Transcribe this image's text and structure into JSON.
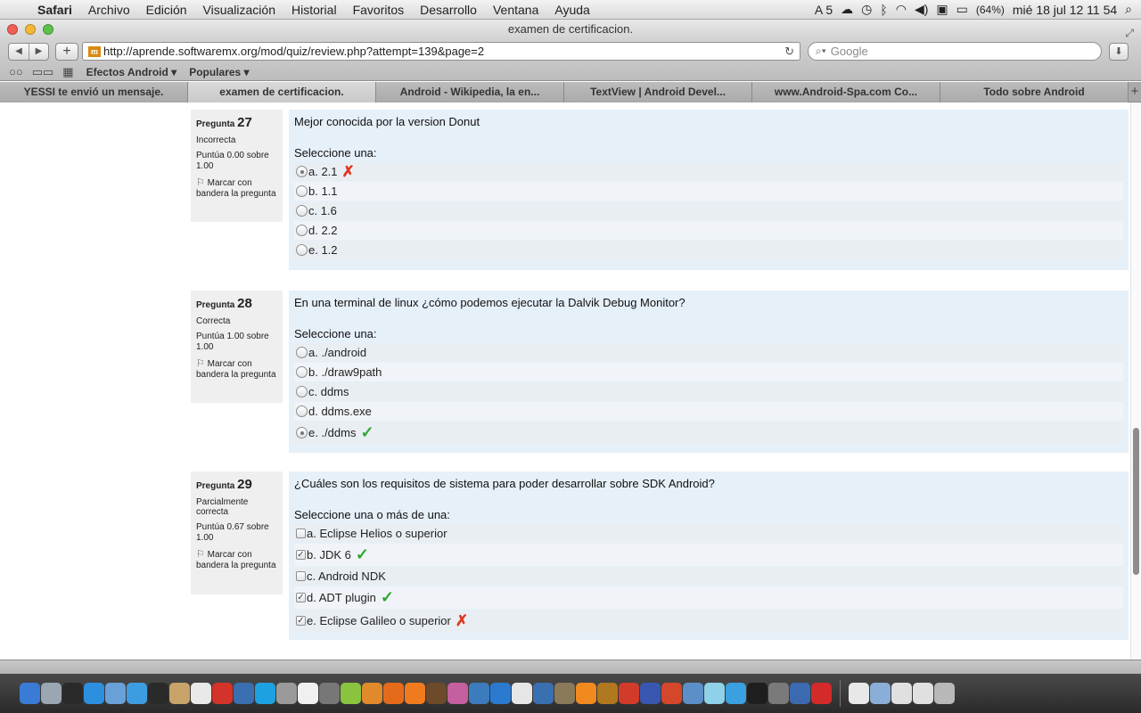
{
  "menubar": {
    "apple": "",
    "items": [
      "Safari",
      "Archivo",
      "Edición",
      "Visualización",
      "Historial",
      "Favoritos",
      "Desarrollo",
      "Ventana",
      "Ayuda"
    ],
    "status_adobe": "5",
    "battery": "(64%)",
    "clock": "mié 18 jul  12 11 54"
  },
  "window": {
    "title": "examen de certificacion."
  },
  "toolbar": {
    "url": "http://aprende.softwaremx.org/mod/quiz/review.php?attempt=139&page=2",
    "favicon": "m",
    "search_placeholder": "Google"
  },
  "bookmarks": [
    "Efectos Android ▾",
    "Populares ▾"
  ],
  "tabs": [
    "YESSI te envió un mensaje.",
    "examen de certificacion.",
    "Android - Wikipedia, la en...",
    "TextView | Android Devel...",
    "www.Android-Spa.com Co...",
    "Todo sobre Android"
  ],
  "questions": [
    {
      "label": "Pregunta",
      "number": "27",
      "state": "Incorrecta",
      "grade": "Puntúa 0.00 sobre 1.00",
      "flag": "Marcar con bandera la pregunta",
      "text": "Mejor conocida por la version Donut",
      "prompt": "Seleccione una:",
      "answers": [
        {
          "text": "a. 2.1",
          "selected": true,
          "mark": "✗"
        },
        {
          "text": "b. 1.1",
          "selected": false,
          "mark": ""
        },
        {
          "text": "c. 1.6",
          "selected": false,
          "mark": ""
        },
        {
          "text": "d. 2.2",
          "selected": false,
          "mark": ""
        },
        {
          "text": "e. 1.2",
          "selected": false,
          "mark": ""
        }
      ]
    },
    {
      "label": "Pregunta",
      "number": "28",
      "state": "Correcta",
      "grade": "Puntúa 1.00 sobre 1.00",
      "flag": "Marcar con bandera la pregunta",
      "text": "En una terminal de linux ¿cómo podemos ejecutar la Dalvik Debug Monitor?",
      "prompt": "Seleccione una:",
      "answers": [
        {
          "text": "a. ./android",
          "selected": false,
          "mark": ""
        },
        {
          "text": "b. ./draw9path",
          "selected": false,
          "mark": ""
        },
        {
          "text": "c. ddms",
          "selected": false,
          "mark": ""
        },
        {
          "text": "d. ddms.exe",
          "selected": false,
          "mark": ""
        },
        {
          "text": "e. ./ddms",
          "selected": true,
          "mark": "✓"
        }
      ]
    },
    {
      "label": "Pregunta",
      "number": "29",
      "state": "Parcialmente correcta",
      "grade": "Puntúa 0.67 sobre 1.00",
      "flag": "Marcar con bandera la pregunta",
      "text": "¿Cuáles son los requisitos de sistema para poder desarrollar sobre SDK Android?",
      "prompt": "Seleccione una o más de una:",
      "answers": [
        {
          "text": "a. Eclipse Helios o superior",
          "selected": false,
          "mark": ""
        },
        {
          "text": "b. JDK 6",
          "selected": true,
          "mark": "✓"
        },
        {
          "text": "c. Android NDK",
          "selected": false,
          "mark": ""
        },
        {
          "text": "d. ADT plugin",
          "selected": true,
          "mark": "✓"
        },
        {
          "text": "e. Eclipse Galileo o superior",
          "selected": true,
          "mark": "✗"
        }
      ]
    }
  ],
  "dock": {
    "icons": [
      "finder-icon",
      "launchpad-icon",
      "dashboard-icon",
      "appstore-icon",
      "preview-icon",
      "safari-icon",
      "x11-icon",
      "cyberduck-icon",
      "calendar-icon",
      "filezilla-icon",
      "virtualbox-icon",
      "skype-icon",
      "utility-icon",
      "textedit-icon",
      "photo-icon",
      "android-icon",
      "blender-icon",
      "firefox-icon",
      "illustrator-icon",
      "lingon-icon",
      "app-icon",
      "compass-icon",
      "photoshop-icon",
      "unity-icon",
      "virtualbox-icon",
      "gimp-icon",
      "vlc-icon",
      "tool-icon",
      "angrybirds-icon",
      "globe-icon",
      "star-icon",
      "doc-icon",
      "itunes-icon",
      "twitter-icon",
      "terminal-icon",
      "sysprefs-icon",
      "pencil-icon",
      "flash-icon",
      "doc2-icon",
      "folder-icon",
      "mail-icon",
      "mail2-icon",
      "trash-icon"
    ],
    "colors": [
      "#3a7bd5",
      "#9aa6b2",
      "#2a2a2a",
      "#2d8fe0",
      "#6aa0d8",
      "#3e9de0",
      "#2a2a2a",
      "#c8a46a",
      "#e9e9e9",
      "#d3332a",
      "#3a6fb0",
      "#1da1e0",
      "#9a9a9a",
      "#f0f0f0",
      "#777777",
      "#8ac43f",
      "#e08a2c",
      "#e46b1c",
      "#f07b1f",
      "#6d4a2a",
      "#c45fa0",
      "#3d7bbf",
      "#2a7bd0",
      "#e6e6e6",
      "#3a6fb0",
      "#8a7a5a",
      "#f08a1f",
      "#b0781f",
      "#d23a2a",
      "#3a57b0",
      "#d4472a",
      "#5c8fc8",
      "#8ed1e8",
      "#3aa0e0",
      "#1e1e1e",
      "#7a7a7a",
      "#3c6ab0",
      "#d52a2a",
      "#e8e8e8",
      "#8aaed8",
      "#e0e0e0",
      "#e0e0e0",
      "#b8b8b8"
    ]
  }
}
